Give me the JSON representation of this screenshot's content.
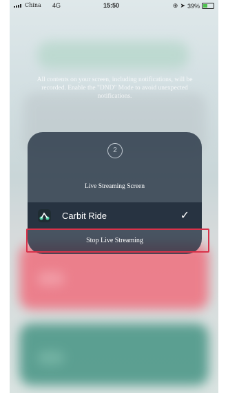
{
  "status_bar": {
    "carrier": "China",
    "network": "4G",
    "time": "15:50",
    "battery": "39%"
  },
  "notice": "All contents on your screen, including notifications, will be recorded. Enable the \"DND\" Mode to avoid unexpected notifications.",
  "dialog": {
    "countdown": "2",
    "title": "Live Streaming Screen",
    "app_name": "Carbit Ride",
    "stop_label": "Stop Live Streaming"
  },
  "colors": {
    "highlight": "#d9324a",
    "battery_fill": "#4ec24e"
  }
}
